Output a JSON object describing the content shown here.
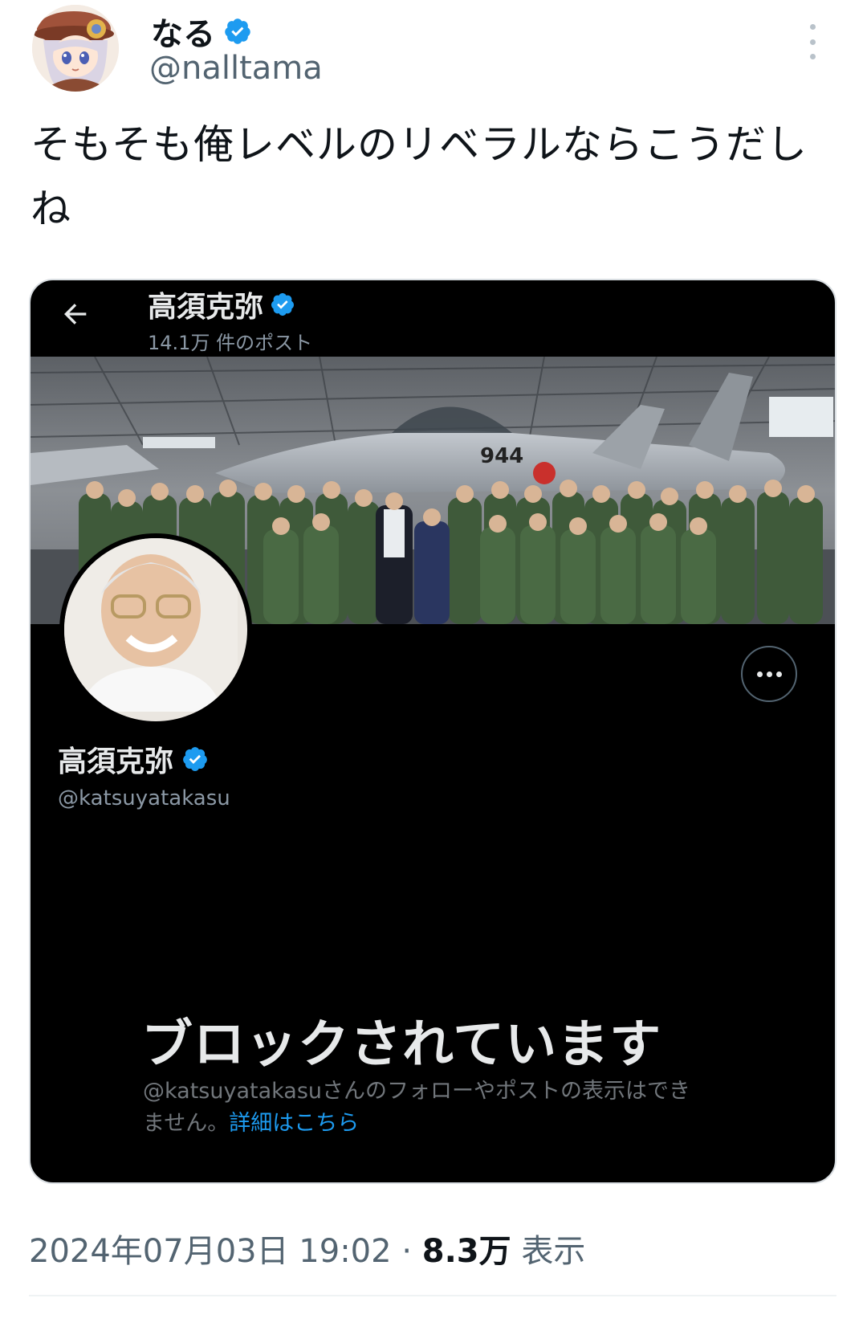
{
  "author": {
    "display_name": "なる",
    "handle": "@nalltama",
    "verified": true
  },
  "tweet": {
    "text": "そもそも俺レベルのリベラルならこうだしね"
  },
  "embedded": {
    "top_name": "高須克弥",
    "post_count": "14.1万 件のポスト",
    "banner_number": "944",
    "profile_name": "高須克弥",
    "profile_handle": "@katsuyatakasu",
    "blocked_title": "ブロックされています",
    "blocked_desc": "@katsuyatakasuさんのフォローやポストの表示はできません。",
    "blocked_link": "詳細はこちら"
  },
  "footer": {
    "timestamp": "2024年07月03日 19:02",
    "separator": "·",
    "views_count": "8.3万",
    "views_label": "表示"
  },
  "colors": {
    "verified_blue": "#1d9bf0",
    "card_bg": "#000000",
    "text_primary": "#0f1419",
    "text_secondary": "#536471"
  }
}
